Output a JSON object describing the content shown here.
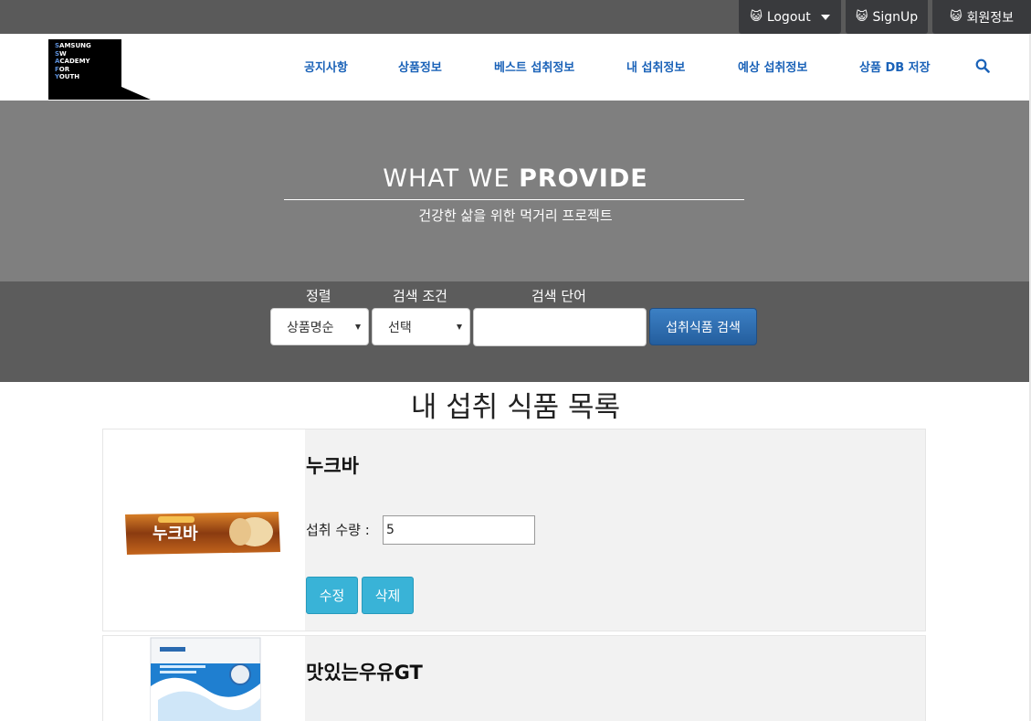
{
  "topbar": {
    "logout_label": "Logout",
    "signup_label": "SignUp",
    "profile_label": "회원정보"
  },
  "logo": {
    "lines": [
      "SAMSUNG",
      "SW",
      "ACADEMY",
      "FOR",
      "YOUTH"
    ]
  },
  "nav": {
    "items": [
      "공지사항",
      "상품정보",
      "베스트 섭취정보",
      "내 섭취정보",
      "예상 섭취정보",
      "상품 DB 저장"
    ]
  },
  "hero": {
    "title_light": "WHAT WE ",
    "title_bold": "PROVIDE",
    "subtitle": "건강한 삶을 위한 먹거리 프로젝트"
  },
  "search": {
    "sort_label": "정렬",
    "condition_label": "검색 조건",
    "keyword_label": "검색 단어",
    "sort_value": "상품명순",
    "condition_value": "선택",
    "keyword_value": "",
    "submit_label": "섭취식품 검색"
  },
  "list": {
    "title": "내 섭취 식품 목록",
    "items": [
      {
        "name": "누크바",
        "qty_label": "섭취 수량 :",
        "qty_value": "5",
        "edit_label": "수정",
        "delete_label": "삭제",
        "image_text": "누크바"
      },
      {
        "name": "맛있는우유GT"
      }
    ]
  },
  "colors": {
    "nav_link": "#1a62b8",
    "hero_bg": "#7f7f7f",
    "search_bg": "#5c5c5c",
    "primary_button": "#2a6aae",
    "info_button": "#39b3d7"
  }
}
